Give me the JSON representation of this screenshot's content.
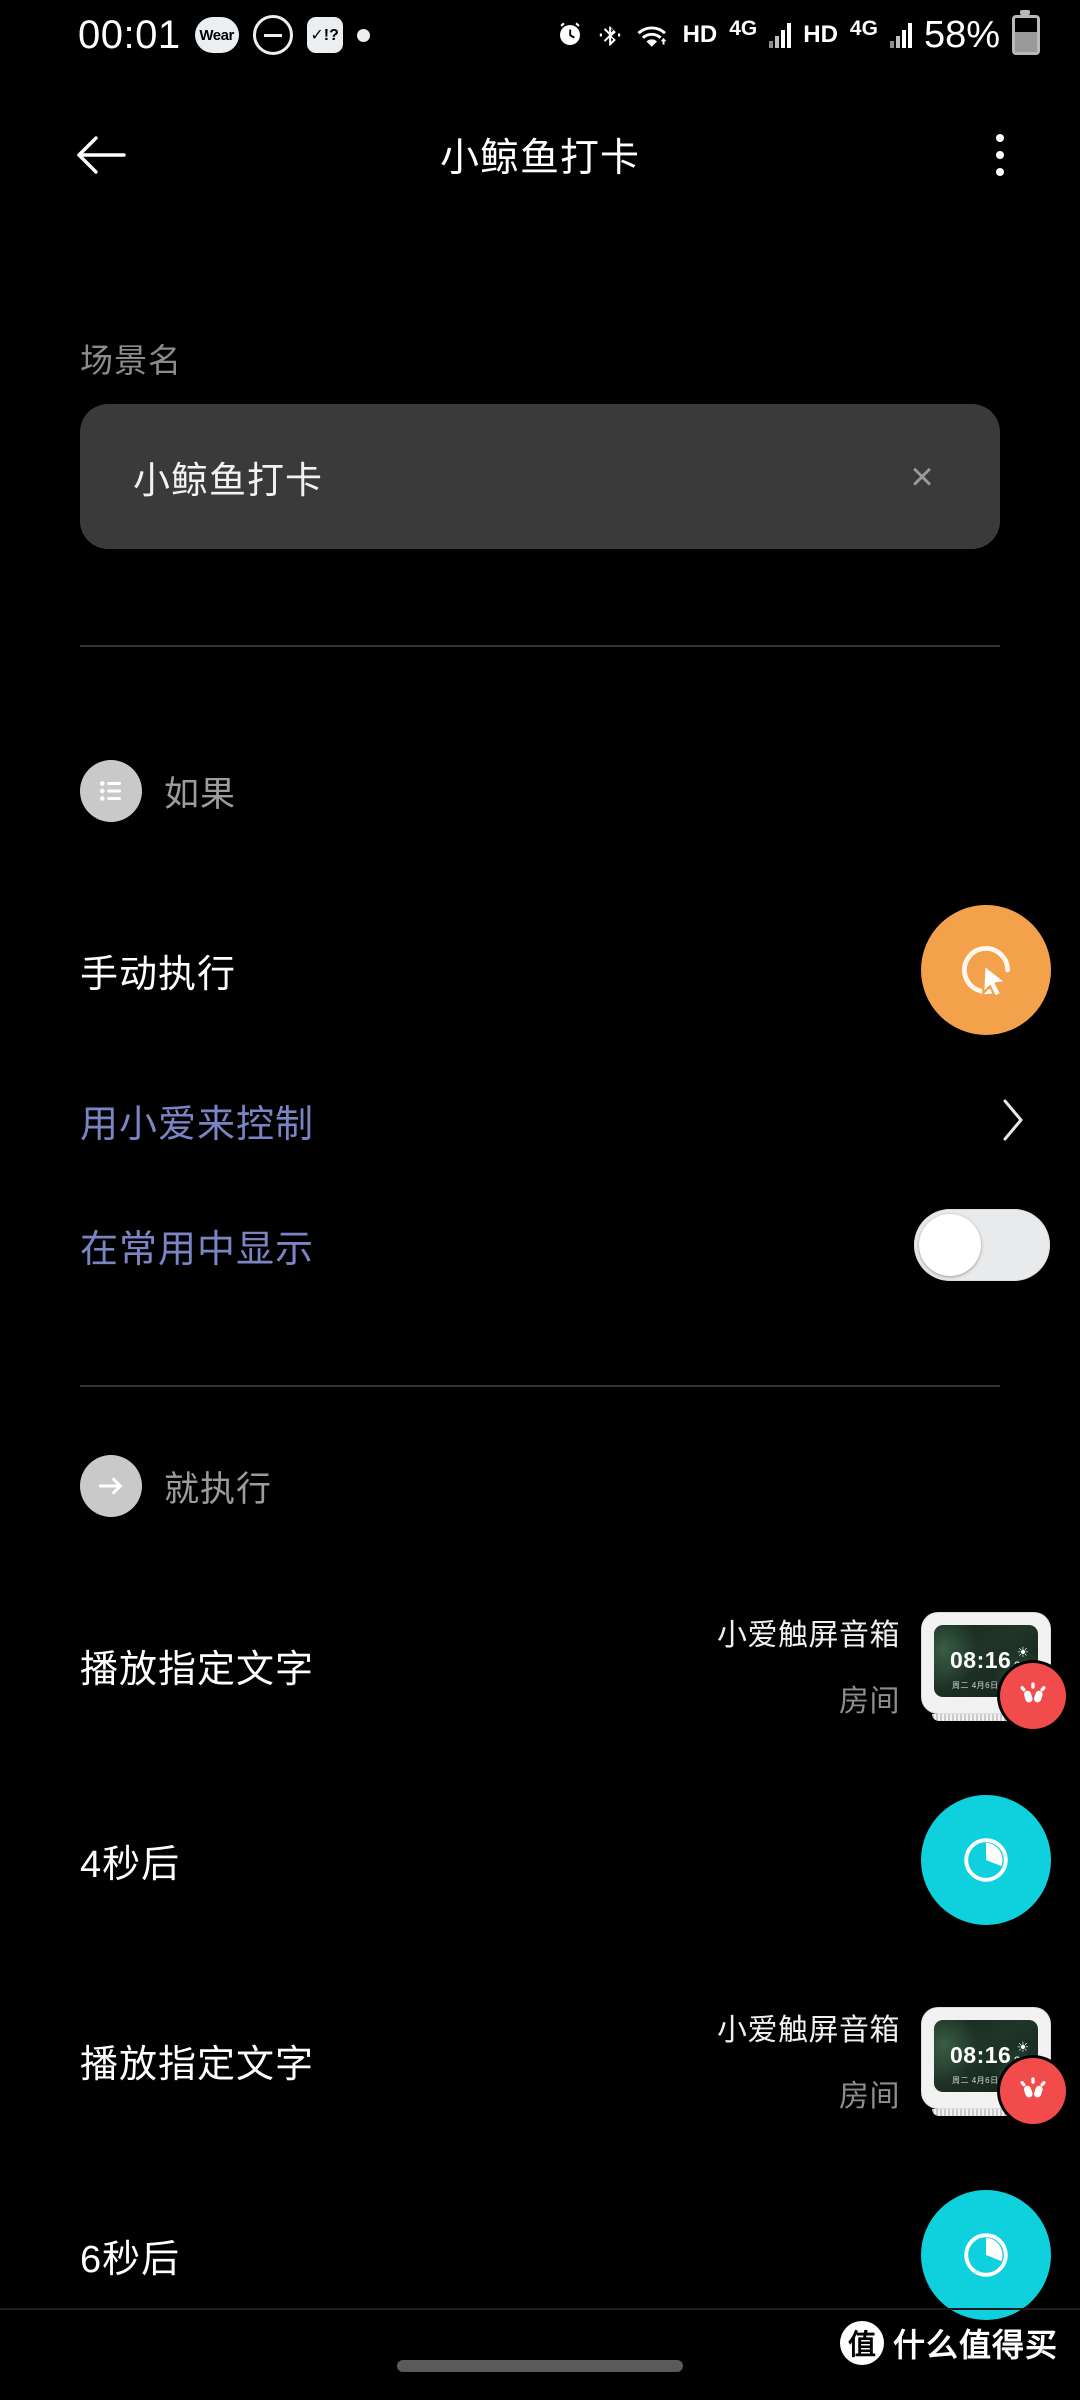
{
  "statusbar": {
    "time": "00:01",
    "wear_badge": "Wear",
    "dnd_icon": "do-not-disturb-icon",
    "task_icon": "check-question-icon",
    "dot_icon": "dot-icon",
    "alarm_icon": "alarm-icon",
    "bluetooth_icon": "bluetooth-icon",
    "wifi_icon": "wifi-icon",
    "sim1_hd": "HD",
    "sim1_net": "4G",
    "sim2_hd": "HD",
    "sim2_net": "4G",
    "battery_pct": "58%"
  },
  "appbar": {
    "back_icon": "back-arrow-icon",
    "title": "小鲸鱼打卡",
    "menu_icon": "overflow-menu-icon"
  },
  "scene": {
    "label": "场景名",
    "value": "小鲸鱼打卡",
    "placeholder": "场景名",
    "clear_icon": "×"
  },
  "if_section": {
    "badge_icon": "list-icon",
    "title": "如果",
    "rows": [
      {
        "label": "手动执行",
        "icon": "manual-trigger-icon",
        "accent": "#f4a14c"
      }
    ],
    "links": [
      {
        "label": "用小爱来控制",
        "icon": "chevron-right-icon",
        "color": "#7b85c4"
      },
      {
        "label": "在常用中显示",
        "toggle": "off",
        "color": "#7b85c4"
      }
    ]
  },
  "then_section": {
    "badge_icon": "arrow-right-icon",
    "title": "就执行",
    "actions": [
      {
        "name": "播放指定文字",
        "device": "小爱触屏音箱",
        "room": "房间",
        "thumb": {
          "clock": "08:16",
          "temp": "26°",
          "date": "周二 4月6日 宜购物",
          "badge_icon": "xiaoai-icon"
        }
      },
      {
        "name": "4秒后",
        "icon": "delay-timer-icon",
        "accent": "#0fd1dd"
      },
      {
        "name": "播放指定文字",
        "device": "小爱触屏音箱",
        "room": "房间",
        "thumb": {
          "clock": "08:16",
          "temp": "26°",
          "date": "周二 4月6日 宜购物",
          "badge_icon": "xiaoai-icon"
        }
      },
      {
        "name": "6秒后",
        "icon": "delay-timer-icon",
        "accent": "#0fd1dd"
      }
    ]
  },
  "watermark": {
    "logo": "值",
    "text": "什么值得买"
  }
}
